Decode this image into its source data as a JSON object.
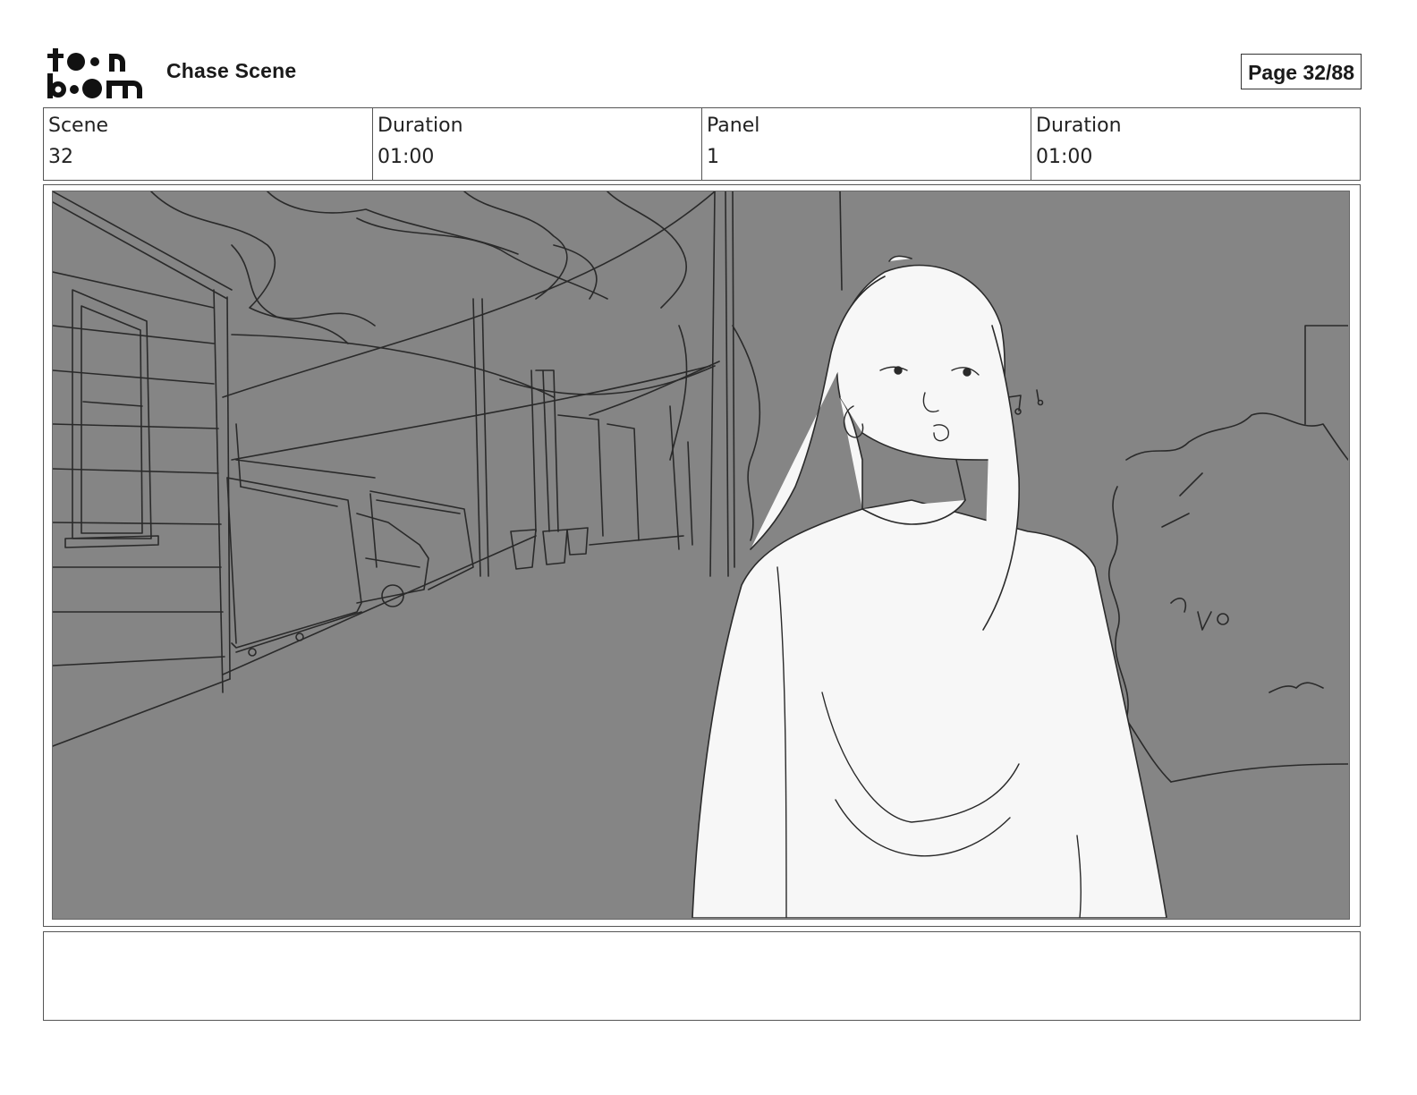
{
  "header": {
    "logo_text": "toonboom",
    "project_title": "Chase Scene",
    "page_label": "Page 32/88"
  },
  "info": {
    "scene_label": "Scene",
    "scene_value": "32",
    "scene_duration_label": "Duration",
    "scene_duration_value": "01:00",
    "panel_label": "Panel",
    "panel_value": "1",
    "panel_duration_label": "Duration",
    "panel_duration_value": "01:00"
  },
  "panel": {
    "background_color": "#858585",
    "line_color": "#2a2a2a",
    "figure_fill": "#f7f7f7"
  },
  "notes": {
    "text": ""
  }
}
